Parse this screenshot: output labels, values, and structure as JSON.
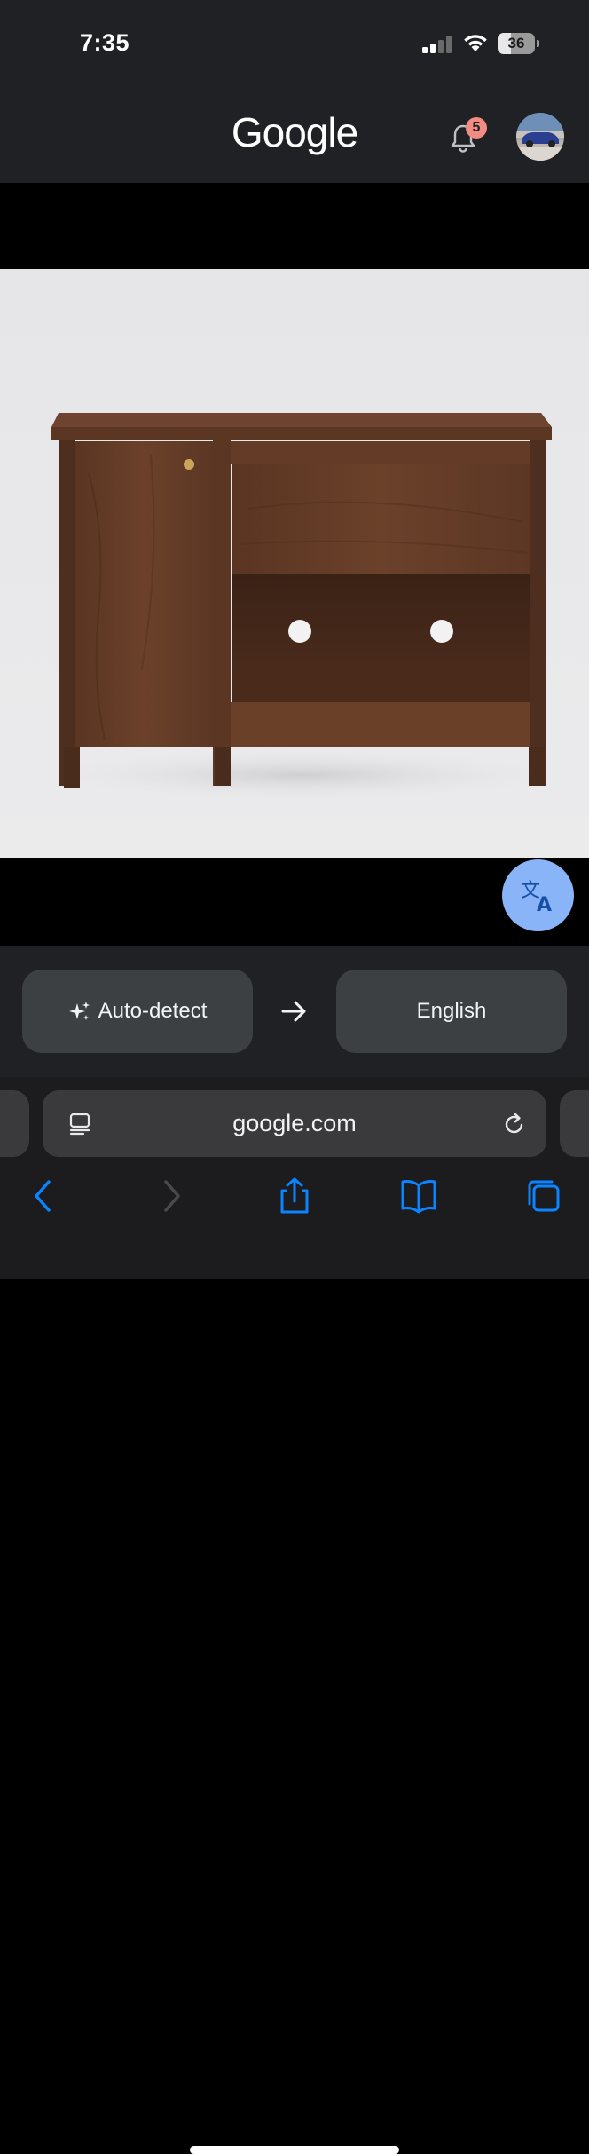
{
  "status_bar": {
    "time": "7:35",
    "battery_percent": "36",
    "battery_level": 0.36,
    "icons": [
      "cellular-signal-icon",
      "wifi-icon",
      "battery-icon"
    ]
  },
  "header": {
    "logo_text": "Google",
    "notification_count": "5",
    "icons": [
      "bell-icon",
      "avatar"
    ]
  },
  "translate": {
    "fab_icon": "translate-icon",
    "source_language": "Auto-detect",
    "source_icon": "sparkle-icon",
    "arrow_icon": "arrow-right-icon",
    "target_language": "English"
  },
  "browser": {
    "address": "google.com",
    "reader_icon": "reader-mode-icon",
    "reload_icon": "reload-icon",
    "toolbar_icons": [
      "back-icon",
      "forward-icon",
      "share-icon",
      "bookmarks-icon",
      "tabs-icon"
    ]
  },
  "colors": {
    "header_bg": "#202124",
    "accent_blue": "#8ab4f8",
    "ios_blue": "#0a84ff",
    "badge": "#f28b82"
  }
}
